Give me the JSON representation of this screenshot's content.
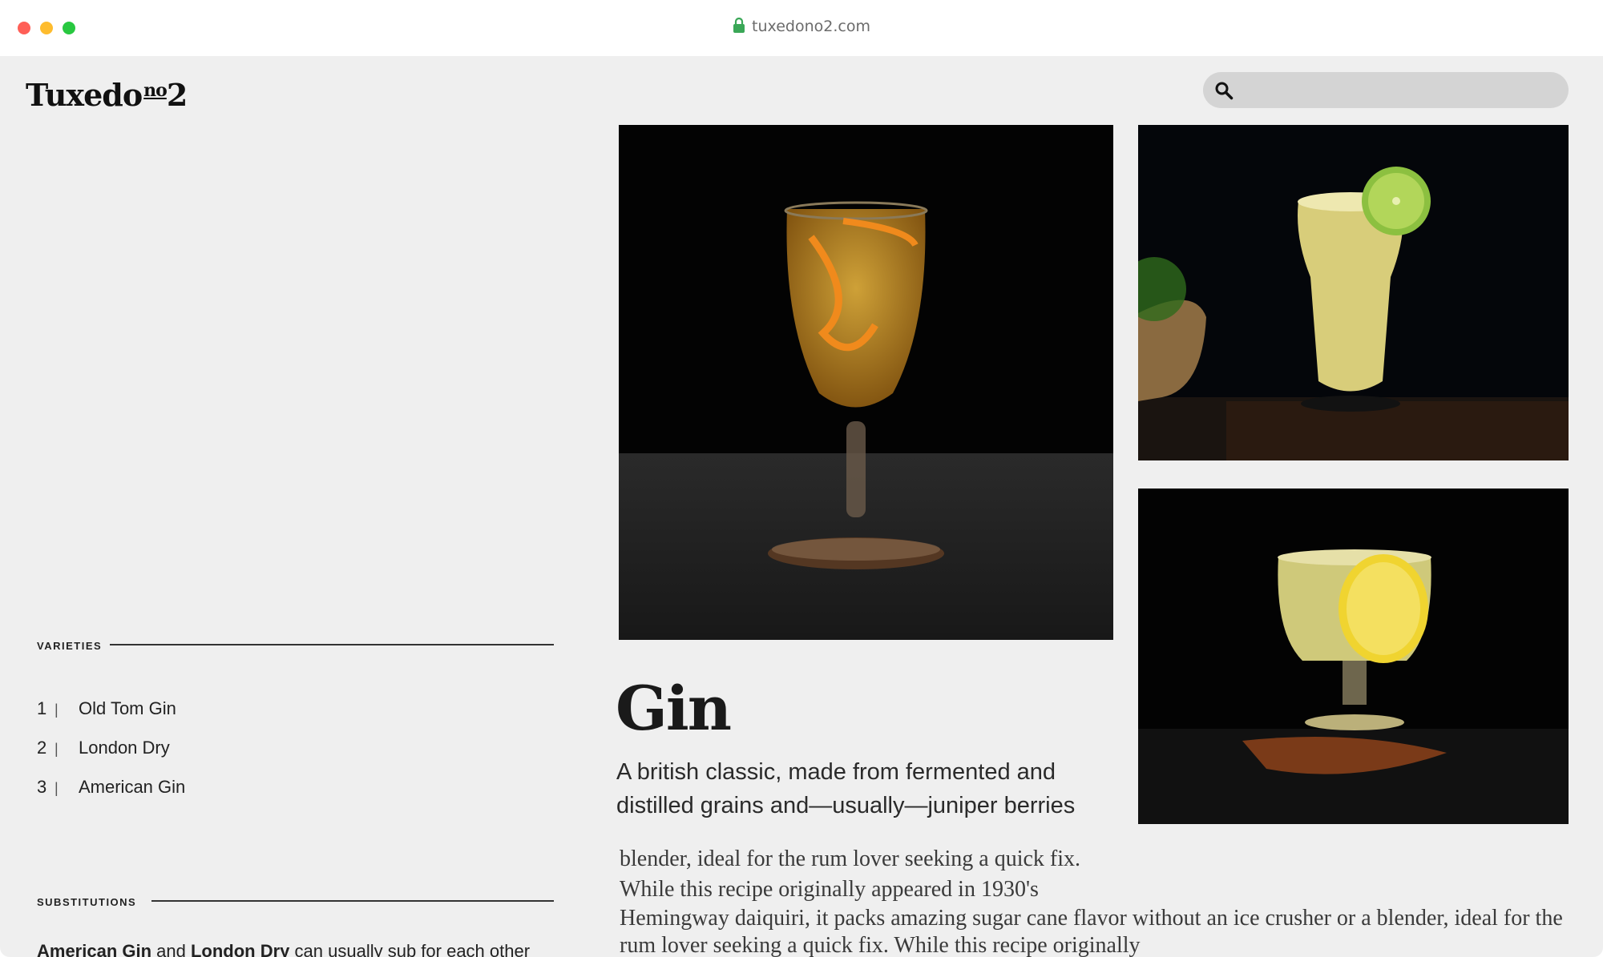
{
  "browser": {
    "url": "tuxedono2.com"
  },
  "header": {
    "logo_text": "Tuxedo",
    "logo_superscript": "no",
    "logo_number": "2",
    "search_placeholder": ""
  },
  "sidebar": {
    "varieties_heading": "VARIETIES",
    "varieties": [
      {
        "number": "1",
        "separator": "|",
        "label": "Old Tom Gin"
      },
      {
        "number": "2",
        "separator": "|",
        "label": "London Dry"
      },
      {
        "number": "3",
        "separator": "|",
        "label": "American Gin"
      }
    ],
    "substitutions_heading": "SUBSTITUTIONS",
    "substitutions": {
      "term1": "American Gin",
      "and": " and ",
      "term2": "London Dry",
      "rest": " can usually sub for each other"
    }
  },
  "main": {
    "title": "Gin",
    "subtitle": "A british classic, made from fermented and distilled grains and—usually—juniper berries",
    "body_paragraph_1": "blender, ideal for the rum lover seeking a quick fix. While this recipe originally appeared in 1930's",
    "body_paragraph_2": "Hemingway daiquiri, it packs amazing sugar cane flavor without an ice crusher or a blender, ideal for the rum lover seeking a quick fix. While this recipe originally"
  },
  "colors": {
    "page_background": "#efefef",
    "search_background": "#d4d4d4",
    "lock_icon": "#3aa757"
  },
  "icons": [
    "lock-icon",
    "search-icon"
  ]
}
